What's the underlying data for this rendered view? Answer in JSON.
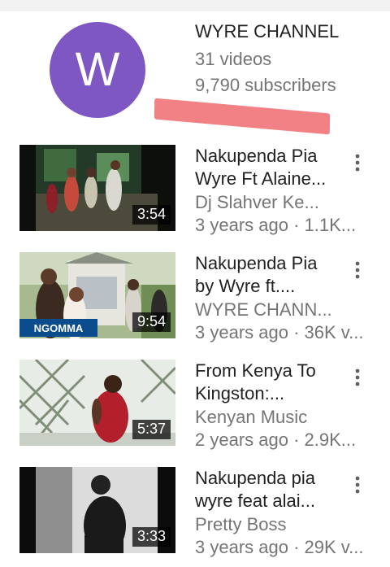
{
  "channel": {
    "avatar_letter": "W",
    "avatar_color": "#7e57c2",
    "name": "WYRE CHANNEL",
    "videos": "31 videos",
    "subscribers": "9,790 subscribers",
    "highlight_color": "#f07a7e"
  },
  "videos": [
    {
      "title_line1": "Nakupenda Pia",
      "title_line2": "Wyre Ft Alaine...",
      "channel": "Dj Slahver Ke...",
      "meta": "3 years ago · 1.1K...",
      "duration": "3:54"
    },
    {
      "title_line1": "Nakupenda Pia",
      "title_line2": "by Wyre ft....",
      "channel": "WYRE CHANN...",
      "meta": "3 years ago · 36K v...",
      "duration": "9:54",
      "thumb_badge": "NGOMMA"
    },
    {
      "title_line1": "From Kenya To",
      "title_line2": "Kingston:...",
      "channel": "Kenyan Music",
      "meta": "2 years ago · 2.9K...",
      "duration": "5:37"
    },
    {
      "title_line1": "Nakupenda pia",
      "title_line2": "wyre feat alai...",
      "channel": "Pretty Boss",
      "meta": "3 years ago · 29K v...",
      "duration": "3:33"
    }
  ],
  "icons": {
    "more": "more-vert-icon"
  }
}
